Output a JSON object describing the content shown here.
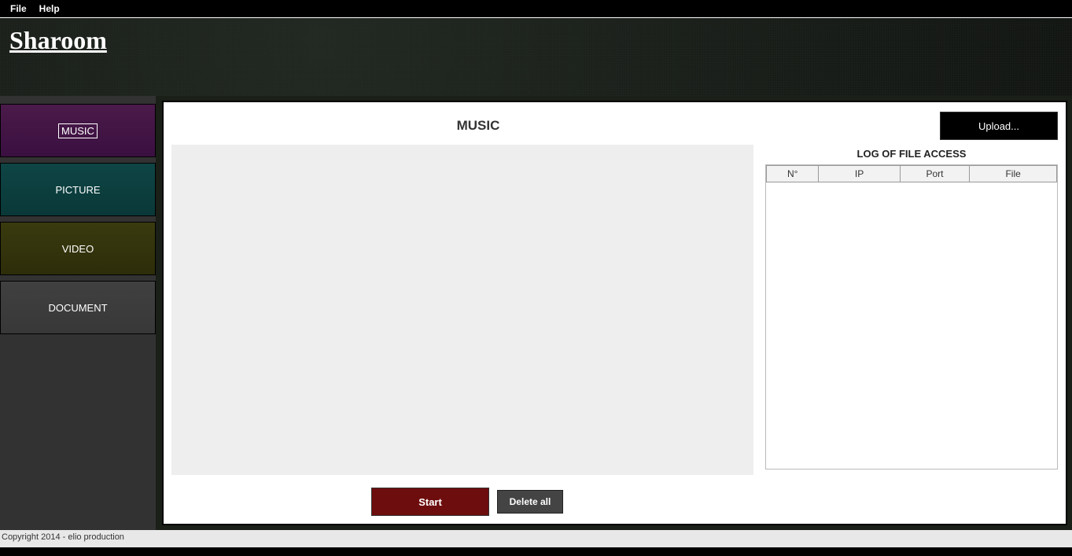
{
  "menubar": {
    "file": "File",
    "help": "Help"
  },
  "app": {
    "title": "Sharoom"
  },
  "sidebar": {
    "music": "MUSIC",
    "picture": "PICTURE",
    "video": "VIDEO",
    "document": "DOCUMENT"
  },
  "content": {
    "title": "MUSIC",
    "upload_label": "Upload...",
    "start_label": "Start",
    "delete_all_label": "Delete all"
  },
  "log": {
    "title": "LOG OF FILE ACCESS",
    "columns": {
      "number": "N°",
      "ip": "IP",
      "port": "Port",
      "file": "File"
    }
  },
  "footer": {
    "copyright": "Copyright 2014 - elio production"
  }
}
